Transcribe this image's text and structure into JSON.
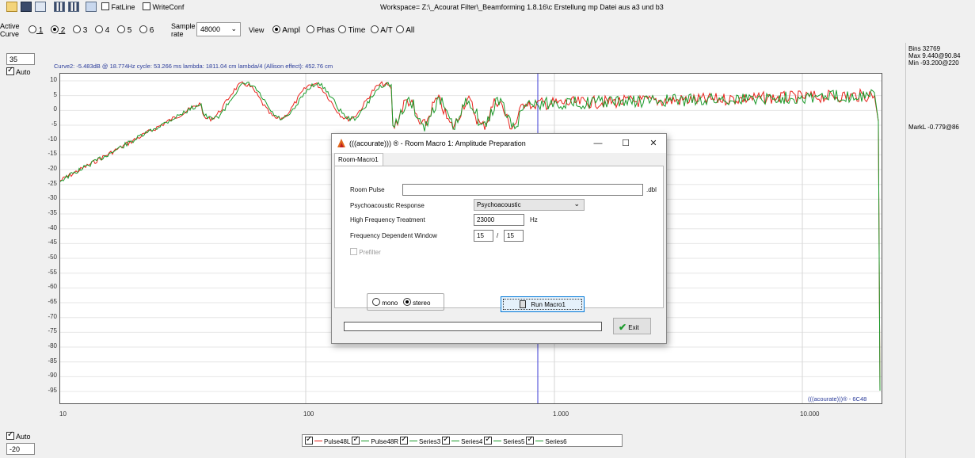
{
  "toolbar": {
    "fatline_label": "FatLine",
    "writeconf_label": "WriteConf",
    "workspace_title": "Workspace= Z:\\_Acourat Filter\\_Beamforming 1.8.16\\c Erstellung  mp Datei aus a3 und b3"
  },
  "controls": {
    "active_curve_label": "Active\nCurve",
    "curves": [
      "1",
      "2",
      "3",
      "4",
      "5",
      "6"
    ],
    "selected_curve": "2",
    "sample_rate_label": "Sample\nrate",
    "sample_rate_value": "48000",
    "view_label": "View",
    "view_options": [
      "Ampl",
      "Phas",
      "Time",
      "A/T",
      "All"
    ],
    "selected_view": "Ampl"
  },
  "left": {
    "top_value": "35",
    "top_auto": "Auto",
    "bottom_auto": "Auto",
    "bottom_value": "-20"
  },
  "plot": {
    "curve_info": "Curve2:  -5.483dB @ 18.774Hz   cycle: 53.266 ms   lambda: 1811.04 cm   lambda/4 (Allison effect): 452.76 cm",
    "watermark": "(((acourate)))® - 6C48",
    "y_ticks": [
      "10",
      "5",
      "0",
      "-5",
      "-10",
      "-15",
      "-20",
      "-25",
      "-30",
      "-35",
      "-40",
      "-45",
      "-50",
      "-55",
      "-60",
      "-65",
      "-70",
      "-75",
      "-80",
      "-85",
      "-90",
      "-95"
    ],
    "x_ticks": [
      "10",
      "100",
      "1.000",
      "10.000"
    ],
    "colors": {
      "red": "#e8221b",
      "green": "#1a9a2a",
      "marker": "#3b3bd6"
    }
  },
  "right_info": {
    "bins": "Bins 32769",
    "max": "Max 9.440@90.84",
    "min": "Min -93.200@220",
    "markl": "MarkL -0.779@86"
  },
  "legend": {
    "items": [
      {
        "label": "Pulse48L",
        "color": "#e8221b"
      },
      {
        "label": "Pulse48R",
        "color": "#1a9a2a"
      },
      {
        "label": "Series3",
        "color": "#1a9a2a"
      },
      {
        "label": "Series4",
        "color": "#1a9a2a"
      },
      {
        "label": "Series5",
        "color": "#1a9a2a"
      },
      {
        "label": "Series6",
        "color": "#1a9a2a"
      }
    ]
  },
  "dialog": {
    "title": "(((acourate))) ® - Room Macro 1: Amplitude Preparation",
    "tab": "Room-Macro1",
    "room_pulse_label": "Room Pulse",
    "room_pulse_value": "",
    "room_pulse_ext": ".dbl",
    "psycho_label": "Psychoacoustic Response",
    "psycho_value": "Psychoacoustic",
    "hf_label": "High Frequency Treatment",
    "hf_value": "23000",
    "hf_unit": "Hz",
    "fdw_label": "Frequency Dependent Window",
    "fdw_value1": "15",
    "fdw_sep": "/",
    "fdw_value2": "15",
    "prefilter_label": "Prefilter",
    "mono_label": "mono",
    "stereo_label": "stereo",
    "run_label": "Run Macro1",
    "exit_label": "Exit"
  }
}
